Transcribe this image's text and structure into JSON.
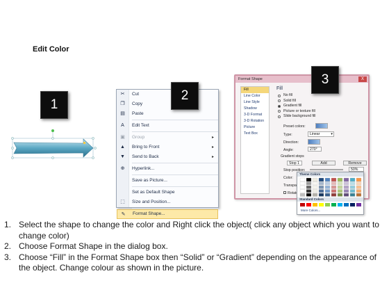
{
  "title": "Edit Color",
  "badges": [
    "1",
    "2",
    "3"
  ],
  "context_menu": {
    "items": [
      {
        "icon": "scissors-icon",
        "label": "Cut",
        "disabled": false
      },
      {
        "icon": "copy-icon",
        "label": "Copy",
        "disabled": false
      },
      {
        "icon": "paste-icon",
        "label": "Paste",
        "disabled": false
      },
      {
        "icon": "edit-text-icon",
        "label": "Edit Text",
        "disabled": false
      },
      {
        "icon": "group-icon",
        "label": "Group",
        "disabled": true,
        "submenu": true
      },
      {
        "icon": "bring-to-front-icon",
        "label": "Bring to Front",
        "disabled": false,
        "submenu": true
      },
      {
        "icon": "send-to-back-icon",
        "label": "Send to Back",
        "disabled": false,
        "submenu": true
      },
      {
        "icon": "hyperlink-icon",
        "label": "Hyperlink...",
        "disabled": false
      },
      {
        "icon": "",
        "label": "Save as Picture...",
        "disabled": false
      },
      {
        "icon": "",
        "label": "Set as Default Shape",
        "disabled": false
      },
      {
        "icon": "size-position-icon",
        "label": "Size and Position...",
        "disabled": false
      },
      {
        "icon": "format-shape-icon",
        "label": "Format Shape...",
        "disabled": false,
        "highlighted": true
      }
    ]
  },
  "format_dialog": {
    "title": "Format Shape",
    "close": "X",
    "nav": [
      "Fill",
      "Line Color",
      "Line Style",
      "Shadow",
      "3-D Format",
      "3-D Rotation",
      "Picture",
      "Text Box"
    ],
    "section": "Fill",
    "options": [
      "No fill",
      "Solid fill",
      "Gradient fill",
      "Picture or texture fill",
      "Slide background fill"
    ],
    "selected_option": "Gradient fill",
    "preset_colors": "Preset colors:",
    "type_label": "Type:",
    "type_value": "Linear",
    "direction_label": "Direction:",
    "angle_label": "Angle:",
    "angle_value": "270°",
    "gradient_stops": "Gradient stops",
    "stop_value": "Stop 1",
    "add": "Add",
    "remove": "Remove",
    "stop_position": "Stop position:",
    "stop_position_value": "50%",
    "color_label": "Color:",
    "transparency": "Transpa",
    "rotate": "Rotate"
  },
  "color_popup": {
    "theme_header": "Theme Colors",
    "standard_header": "Standard Colors",
    "more": "More Colors...",
    "theme_top": [
      "#ffffff",
      "#000000",
      "#eeece1",
      "#1f497d",
      "#4f81bd",
      "#c0504d",
      "#9bbb59",
      "#8064a2",
      "#4bacc6",
      "#f79646"
    ],
    "standard": [
      "#c00000",
      "#ff0000",
      "#ffc000",
      "#ffff00",
      "#92d050",
      "#00b050",
      "#00b0f0",
      "#0070c0",
      "#002060",
      "#7030a0"
    ]
  },
  "instructions": [
    {
      "num": "1.",
      "text": "Select the shape to change the color and Right click the object( click any object which you want to change color)"
    },
    {
      "num": "2.",
      "text": "Choose Format Shape in the dialog box."
    },
    {
      "num": "3.",
      "text": "Choose “Fill” in the Format Shape box then “Solid” or “Gradient” depending on the appearance of the object. Change colour as shown in the picture."
    }
  ],
  "colors": {
    "shape_fill": "#5ba8c4",
    "highlight": "#fde9a8",
    "dialog_border": "#cf95a6"
  }
}
